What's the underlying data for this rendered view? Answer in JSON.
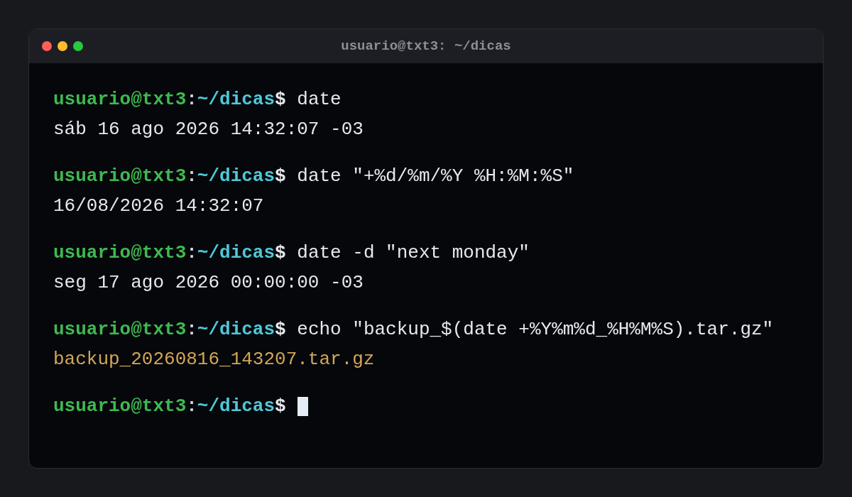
{
  "window": {
    "title": "usuario@txt3: ~/dicas",
    "controls": [
      {
        "color": "#ff5f57"
      },
      {
        "color": "#febc2e"
      },
      {
        "color": "#28c840"
      }
    ]
  },
  "blocks": [
    {
      "prompt": {
        "user": "usuario@txt3",
        "separator": ":",
        "path": "~/dicas",
        "symbol": "$"
      },
      "command": "date",
      "output": {
        "kind": "plain",
        "text": "sáb 16 ago 2026 14:32:07 -03"
      }
    },
    {
      "prompt": {
        "user": "usuario@txt3",
        "separator": ":",
        "path": "~/dicas",
        "symbol": "$"
      },
      "command": "date \"+%d/%m/%Y %H:%M:%S\"",
      "output": {
        "kind": "plain",
        "text": "16/08/2026 14:32:07"
      }
    },
    {
      "prompt": {
        "user": "usuario@txt3",
        "separator": ":",
        "path": "~/dicas",
        "symbol": "$"
      },
      "command": "date -d \"next monday\"",
      "output": {
        "kind": "plain",
        "text": "seg 17 ago 2026 00:00:00 -03"
      }
    },
    {
      "prompt": {
        "user": "usuario@txt3",
        "separator": ":",
        "path": "~/dicas",
        "symbol": "$"
      },
      "command": "echo \"backup_$(date +%Y%m%d_%H%M%S).tar.gz\"",
      "output": {
        "kind": "highlight",
        "text": "backup_20260816_143207.tar.gz"
      }
    },
    {
      "prompt": {
        "user": "usuario@txt3",
        "separator": ":",
        "path": "~/dicas",
        "symbol": "$"
      },
      "cursor": true
    }
  ]
}
